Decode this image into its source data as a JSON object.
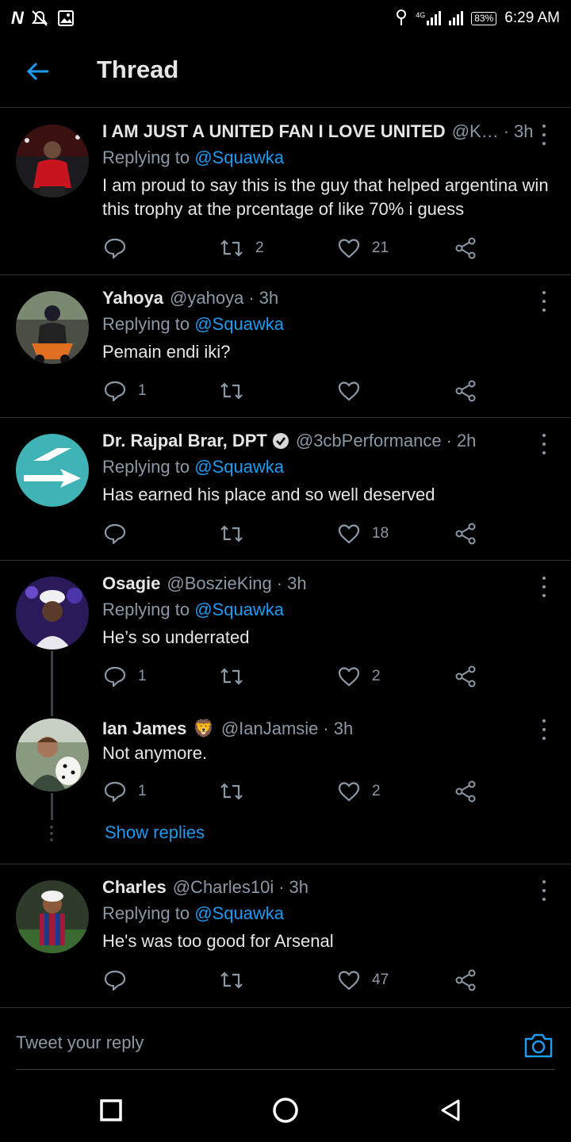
{
  "status_bar": {
    "carrier_logo": "N",
    "network": "4G",
    "battery": "83%",
    "time": "6:29 AM"
  },
  "header": {
    "title": "Thread",
    "back_icon": "arrow-left-icon"
  },
  "colors": {
    "accent": "#1d9bf0",
    "background": "#000000",
    "muted": "#8b98a5",
    "text": "#e6e6e6",
    "divider": "#2f3336"
  },
  "tweets": [
    {
      "name": "I AM JUST A UNITED FAN I LOVE UNITED",
      "handle": "@K…",
      "time": "3h",
      "replying_prefix": "Replying to",
      "replying_to": "@Squawka",
      "text": "I am proud to say this is the guy that helped argentina win this trophy at the prcentage of like 70% i guess",
      "replies": "",
      "retweets": "2",
      "likes": "21"
    },
    {
      "name": "Yahoya",
      "handle": "@yahoya",
      "time": "3h",
      "replying_prefix": "Replying to",
      "replying_to": "@Squawka",
      "text": "Pemain endi iki?",
      "replies": "1",
      "retweets": "",
      "likes": ""
    },
    {
      "name": "Dr. Rajpal Brar, DPT",
      "verified": true,
      "handle": "@3cbPerformance",
      "time": "2h",
      "replying_prefix": "Replying to",
      "replying_to": "@Squawka",
      "text": "Has earned his place and so well deserved",
      "replies": "",
      "retweets": "",
      "likes": "18"
    },
    {
      "name": "Osagie",
      "handle": "@BoszieKing",
      "time": "3h",
      "replying_prefix": "Replying to",
      "replying_to": "@Squawka",
      "text": "He’s so underrated",
      "replies": "1",
      "retweets": "",
      "likes": "2"
    },
    {
      "name": "Ian James",
      "name_emoji": "🦁",
      "handle": "@IanJamsie",
      "time": "3h",
      "text": "Not anymore.",
      "replies": "1",
      "retweets": "",
      "likes": "2",
      "show_replies": "Show replies"
    },
    {
      "name": "Charles",
      "handle": "@Charles10i",
      "time": "3h",
      "replying_prefix": "Replying to",
      "replying_to": "@Squawka",
      "text": "He's was too good for Arsenal",
      "replies": "",
      "retweets": "",
      "likes": "47"
    }
  ],
  "composer": {
    "placeholder": "Tweet your reply",
    "camera_icon": "camera-icon"
  },
  "nav_bar": {
    "recents_icon": "square-icon",
    "home_icon": "circle-icon",
    "back_icon": "triangle-back-icon"
  }
}
